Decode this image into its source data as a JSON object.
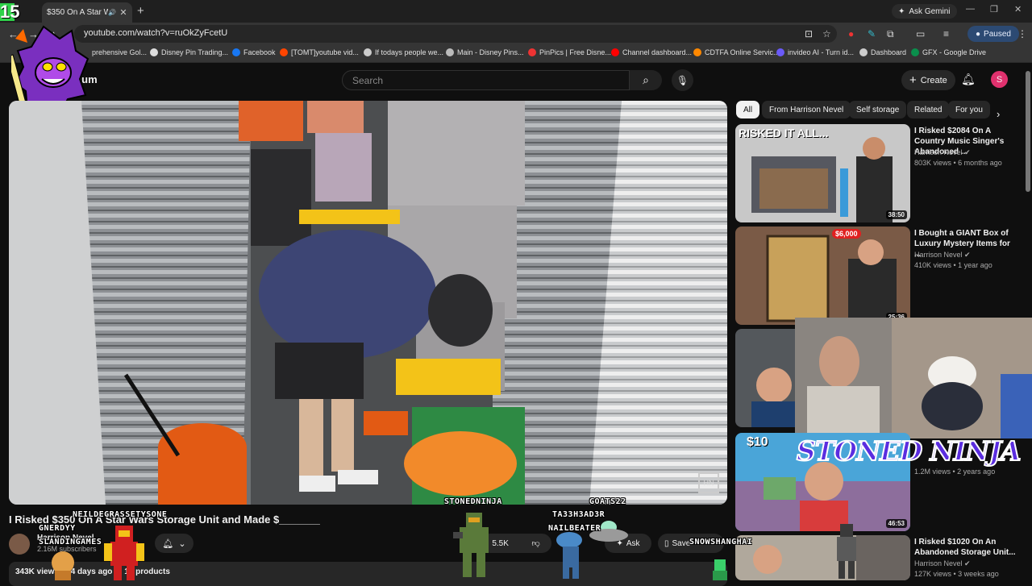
{
  "browser": {
    "tab_title": "$350 On A Star Wa",
    "new_tab": "+",
    "gemini": "Ask Gemini",
    "url": "youtube.com/watch?v=ruOkZyFcetU",
    "paused": "Paused",
    "bookmarks": [
      "prehensive Gol...",
      "Disney Pin Trading...",
      "Facebook",
      "[TOMT]youtube vid...",
      "If todays people we...",
      "Main - Disney Pins...",
      "PinPics | Free Disne...",
      "Channel dashboard...",
      "CDTFA Online Servic...",
      "invideo AI - Turn id...",
      "Dashboard",
      "GFX - Google Drive"
    ]
  },
  "youtube": {
    "logo": "mium",
    "search_placeholder": "Search",
    "create": "Create",
    "avatar_letter": "S"
  },
  "video": {
    "title": "I Risked $350 On A Star Wars Storage Unit and Made $_______",
    "channel": "Harrison Nevel",
    "subscribers": "2.16M subscribers",
    "likes": "5.5K",
    "ask": "Ask",
    "save": "Save",
    "views": "343K views",
    "age": "4 days ago",
    "products": "13 products",
    "watermark": "HN"
  },
  "overlay": {
    "counter": "15",
    "names": {
      "n1": "NEILDEGRASSETYSONE",
      "n2": "GNERDYY",
      "n3": "SLANDINGAMES",
      "n4": "STONEDNINJA",
      "n5": "GOATS22",
      "n6": "TA33H3AD3R",
      "n7": "NAILBEATER",
      "n8": "SNOWSHANGHAI"
    },
    "stoned_banner": "STONED NINJA"
  },
  "chips": [
    "All",
    "From Harrison Nevel",
    "Self storage",
    "Related",
    "For you"
  ],
  "recommendations": [
    {
      "title": "I Risked $2084 On A Country Music Singer's Abandoned ...",
      "channel": "Harrison Nevel",
      "meta": "803K views • 6 months ago",
      "duration": "38:50",
      "thumb_text": "RISKED IT ALL..."
    },
    {
      "title": "I Bought a GIANT Box of Luxury Mystery Items for ...",
      "channel": "Harrison Nevel",
      "meta": "410K views • 1 year ago",
      "duration": "25:36",
      "thumb_text": "$6,000"
    },
    {
      "title": "",
      "channel": "",
      "meta": "",
      "duration": "",
      "thumb_text": ""
    },
    {
      "title": "",
      "channel": "",
      "meta": "1.2M views • 2 years ago",
      "duration": "46:53",
      "thumb_text": "$10"
    },
    {
      "title": "I Risked $1020 On An Abandoned Storage Unit...",
      "channel": "Harrison Nevel",
      "meta": "127K views • 3 weeks ago",
      "duration": "",
      "thumb_text": ""
    }
  ],
  "colors": {
    "accent": "#e0316e",
    "bg": "#0f0f0f",
    "chip": "#272727"
  }
}
